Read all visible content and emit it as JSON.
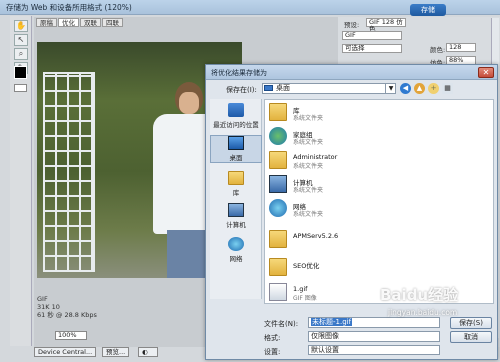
{
  "window": {
    "title": "存储为 Web 和设备所用格式 (120%)",
    "tabs": [
      "原稿",
      "优化",
      "双联",
      "四联"
    ],
    "active_tab": 1
  },
  "right_panel": {
    "save_button": "存储",
    "preset_label": "预设:",
    "preset_value": "GIF 128 仿色",
    "format_value": "GIF",
    "reduction_value": "可选择",
    "colors_label": "颜色:",
    "colors_value": "128",
    "dither_label": "仿色:",
    "dither_value": "88%"
  },
  "image_info": {
    "format": "GIF",
    "size": "31K 10",
    "speed": "61 秒 @ 28.8 Kbps"
  },
  "status": {
    "zoom": "100%",
    "device_central": "Device Central...",
    "preview": "预览..."
  },
  "dialog": {
    "title": "将优化结果存储为",
    "save_in_label": "保存在(I):",
    "save_in_value": "桌面",
    "close_glyph": "✕",
    "places": [
      {
        "label": "最近访问的位置",
        "icon": "recent-places-icon"
      },
      {
        "label": "桌面",
        "icon": "desktop-icon"
      },
      {
        "label": "库",
        "icon": "libraries-icon"
      },
      {
        "label": "计算机",
        "icon": "computer-icon"
      },
      {
        "label": "网络",
        "icon": "network-icon"
      }
    ],
    "files": [
      {
        "name": "库",
        "sub": "系统文件夹",
        "icon": "library-folder-icon"
      },
      {
        "name": "家庭组",
        "sub": "系统文件夹",
        "icon": "homegroup-icon"
      },
      {
        "name": "Administrator",
        "sub": "系统文件夹",
        "icon": "user-folder-icon"
      },
      {
        "name": "计算机",
        "sub": "系统文件夹",
        "icon": "computer-icon"
      },
      {
        "name": "网络",
        "sub": "系统文件夹",
        "icon": "network-icon"
      },
      {
        "name": "APMServ5.2.6",
        "sub": "",
        "icon": "folder-icon"
      },
      {
        "name": "SEO优化",
        "sub": "",
        "icon": "folder-icon"
      },
      {
        "name": "1.gif",
        "sub": "GIF 图像",
        "icon": "gif-file-icon"
      }
    ],
    "filename_label": "文件名(N):",
    "filename_value": "未标题-1.gif",
    "filetype_label": "格式:",
    "filetype_value": "仅限图像",
    "settings_label": "设置:",
    "settings_value": "默认设置",
    "save_button": "保存(S)",
    "cancel_button": "取消"
  },
  "watermark": {
    "logo": "Baidu经验",
    "url": "jingyan.baidu.com"
  }
}
